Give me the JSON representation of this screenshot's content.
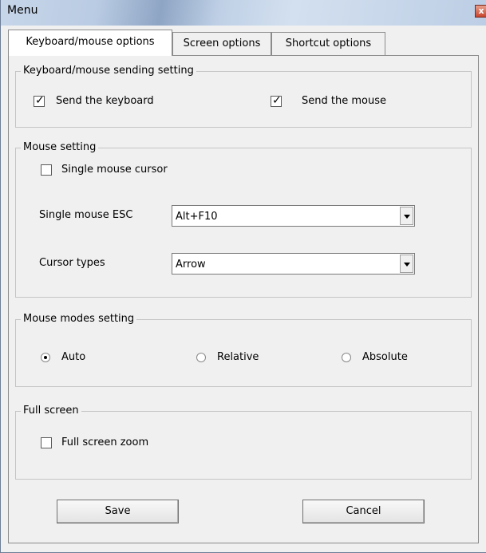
{
  "window": {
    "title": "Menu",
    "close_glyph": "x"
  },
  "tabs": [
    {
      "label": "Keyboard/mouse options",
      "active": true
    },
    {
      "label": "Screen options",
      "active": false
    },
    {
      "label": "Shortcut options",
      "active": false
    }
  ],
  "keyboard_mouse_group": {
    "title": "Keyboard/mouse sending setting",
    "send_keyboard": {
      "label": "Send the keyboard",
      "checked": true
    },
    "send_mouse": {
      "label": "Send the mouse",
      "checked": true
    }
  },
  "mouse_setting_group": {
    "title": "Mouse setting",
    "single_cursor": {
      "label": "Single mouse cursor",
      "checked": false
    },
    "single_esc": {
      "label": "Single mouse ESC",
      "value": "Alt+F10"
    },
    "cursor_types": {
      "label": "Cursor types",
      "value": "Arrow"
    }
  },
  "mouse_modes_group": {
    "title": "Mouse modes setting",
    "options": [
      {
        "label": "Auto",
        "selected": true
      },
      {
        "label": "Relative",
        "selected": false
      },
      {
        "label": "Absolute",
        "selected": false
      }
    ]
  },
  "full_screen_group": {
    "title": "Full screen",
    "zoom": {
      "label": "Full screen zoom",
      "checked": false
    }
  },
  "buttons": {
    "save": "Save",
    "cancel": "Cancel"
  },
  "icons": {
    "checkbox_checked": "checkmark-icon",
    "radio_selected": "radio-dot-icon",
    "dropdown": "chevron-down-icon",
    "close": "close-icon"
  }
}
